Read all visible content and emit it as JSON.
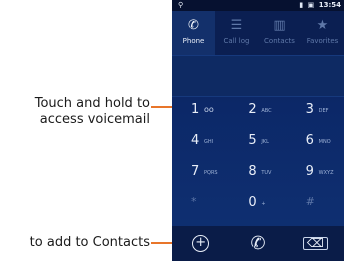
{
  "callouts": {
    "voicemail_line1": "Touch and hold to",
    "voicemail_line2": "access voicemail",
    "contacts": "to add to Contacts"
  },
  "status_bar": {
    "time": "13:54"
  },
  "tabs": [
    {
      "label": "Phone",
      "icon": "phone-icon",
      "active": true
    },
    {
      "label": "Call log",
      "icon": "call-log-icon",
      "active": false
    },
    {
      "label": "Contacts",
      "icon": "contacts-icon",
      "active": false
    },
    {
      "label": "Favorites",
      "icon": "star-icon",
      "active": false
    }
  ],
  "keypad": [
    [
      {
        "digit": "1",
        "letters": ""
      },
      {
        "digit": "2",
        "letters": "ABC"
      },
      {
        "digit": "3",
        "letters": "DEF"
      }
    ],
    [
      {
        "digit": "4",
        "letters": "GHI"
      },
      {
        "digit": "5",
        "letters": "JKL"
      },
      {
        "digit": "6",
        "letters": "MNO"
      }
    ],
    [
      {
        "digit": "7",
        "letters": "PQRS"
      },
      {
        "digit": "8",
        "letters": "TUV"
      },
      {
        "digit": "9",
        "letters": "WXYZ"
      }
    ],
    [
      {
        "digit": "*",
        "letters": ""
      },
      {
        "digit": "0",
        "letters": "+"
      },
      {
        "digit": "#",
        "letters": ""
      }
    ]
  ],
  "actions": [
    "add-contact-icon",
    "call-icon",
    "backspace-icon"
  ],
  "colors": {
    "accent": "#e8752a",
    "background": "#0c2868"
  }
}
